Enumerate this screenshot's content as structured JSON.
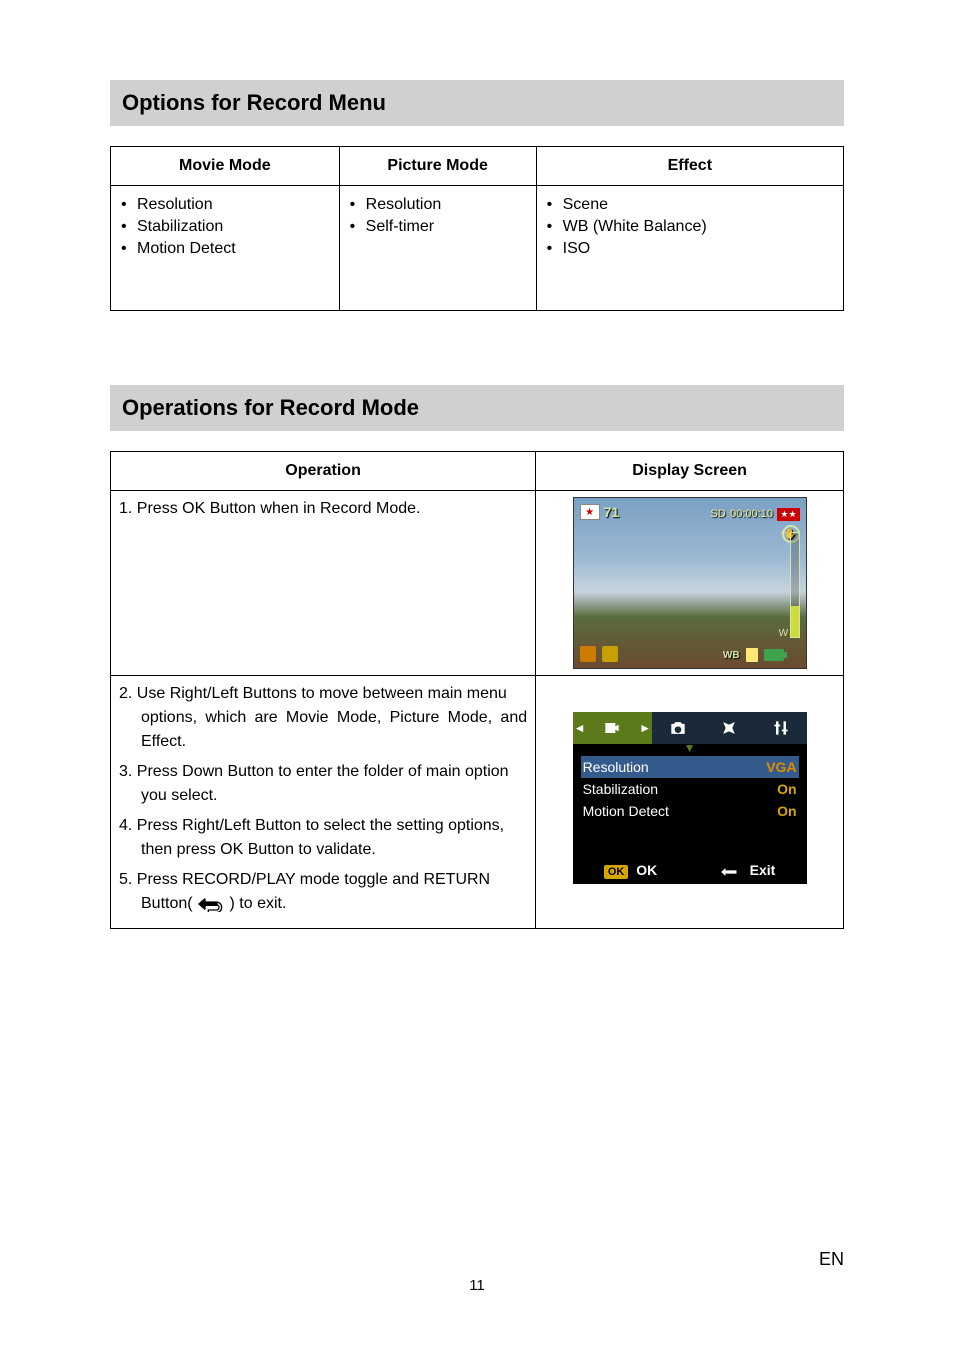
{
  "page_number": "11",
  "lang": "EN",
  "section1": {
    "title": "Options for Record Menu",
    "columns": {
      "movie": "Movie Mode",
      "picture": "Picture Mode",
      "effect": "Effect"
    },
    "items": {
      "movie": [
        "Resolution",
        "Stabilization",
        "Motion Detect"
      ],
      "picture": [
        "Resolution",
        "Self-timer"
      ],
      "effect": [
        "Scene",
        "WB (White Balance)",
        "ISO"
      ]
    }
  },
  "section2": {
    "title": "Operations for Record Mode",
    "headers": {
      "operation": "Operation",
      "display": "Display Screen"
    },
    "row1": {
      "step1": "1. Press OK Button when in Record Mode.",
      "preview": {
        "count": "71",
        "time_prefix": "SD",
        "time": "00:00:10",
        "wb": "WB"
      }
    },
    "row2": {
      "step2a": "2. Use Right/Left Buttons to move between main menu",
      "step2b": "options, which are Movie Mode, Picture Mode, and Effect.",
      "step3a": "3. Press Down Button to enter the folder of main option",
      "step3b": "you select.",
      "step4a": "4. Press Right/Left Button to select the setting options,",
      "step4b": "then press OK Button to validate.",
      "step5a": "5. Press RECORD/PLAY mode toggle and RETURN",
      "step5b_prefix": "Button(",
      "step5b_suffix": ") to exit.",
      "menu": {
        "rows": [
          {
            "label": "Resolution",
            "value": "VGA"
          },
          {
            "label": "Stabilization",
            "value": "On"
          },
          {
            "label": "Motion Detect",
            "value": "On"
          }
        ],
        "ok_badge": "OK",
        "ok": "OK",
        "exit": "Exit"
      }
    }
  }
}
